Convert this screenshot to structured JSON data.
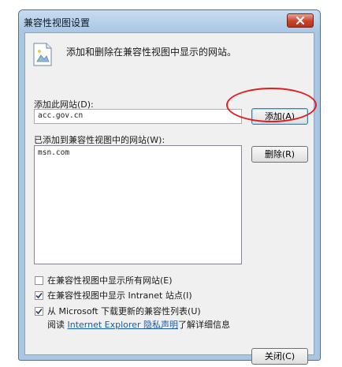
{
  "window": {
    "title": "兼容性视图设置",
    "close_icon": "close-x-icon"
  },
  "header": {
    "icon": "webpage-picture-icon",
    "text": "添加和删除在兼容性视图中显示的网站。"
  },
  "add_site": {
    "label": "添加此网站(D):",
    "value": "acc.gov.cn",
    "button_label": "添加(A)"
  },
  "added_sites": {
    "label": "已添加到兼容性视图中的网站(W):",
    "items": [
      "msn.com"
    ],
    "remove_label": "删除(R)"
  },
  "options": [
    {
      "label": "在兼容性视图中显示所有网站(E)",
      "checked": false
    },
    {
      "label": "在兼容性视图中显示 Intranet 站点(I)",
      "checked": true
    },
    {
      "label": "从 Microsoft 下载更新的兼容性列表(U)",
      "checked": true
    }
  ],
  "privacy": {
    "prefix": "阅读",
    "link_text": "Internet Explorer 隐私声明",
    "suffix": "了解详细信息"
  },
  "footer": {
    "close_label": "关闭(C)"
  },
  "colors": {
    "annotation_oval": "#e02020"
  }
}
